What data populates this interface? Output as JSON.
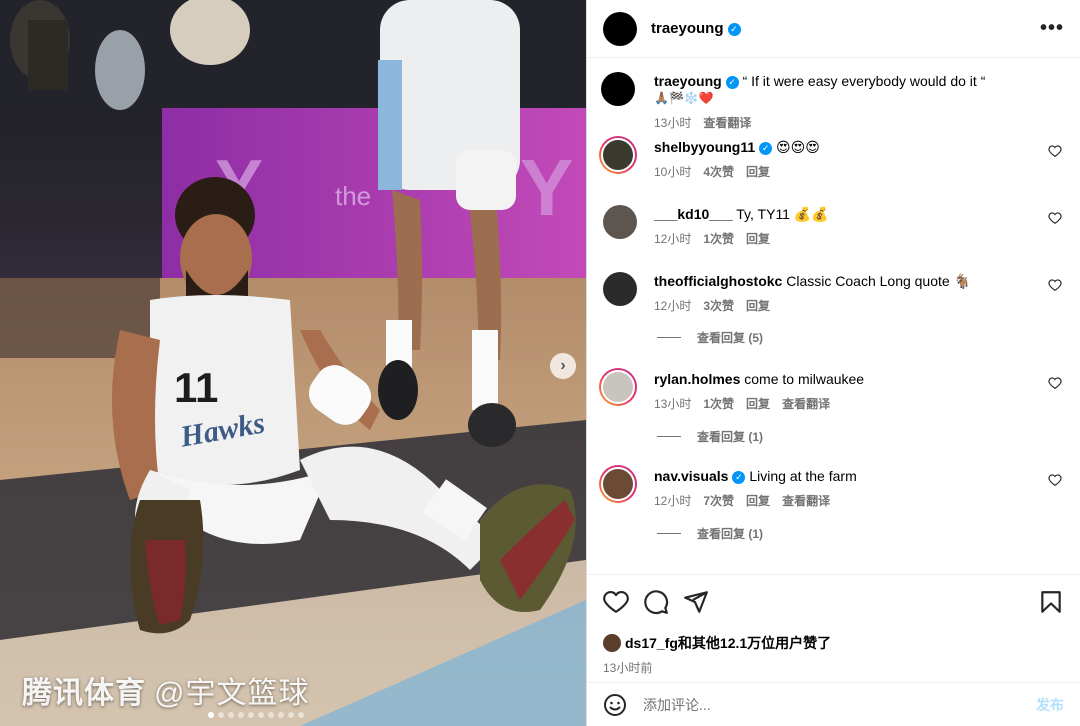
{
  "photo": {
    "jersey_number": "11",
    "jersey_text": "Hawks",
    "watermark_brand": "腾讯体育",
    "watermark_handle": "@宇文篮球",
    "next_icon": "chevron-right-icon",
    "carousel": {
      "total": 10,
      "active_index": 0
    }
  },
  "header": {
    "username": "traeyoung",
    "verified": true,
    "more_icon": "more-horizontal-icon"
  },
  "caption": {
    "username": "traeyoung",
    "text": "“ If it were easy everybody would do it “",
    "emoji_line": "🙏🏽🏁❄️❤️",
    "time": "13小时",
    "translate": "查看翻译"
  },
  "comments": [
    {
      "username": "shelbyyoung11",
      "verified": true,
      "text": "😍😍😍",
      "time": "10小时",
      "likes": "4次赞",
      "reply": "回复",
      "translate": "",
      "view_replies": ""
    },
    {
      "username": "___kd10___",
      "verified": false,
      "text": "Ty, TY11 💰💰",
      "time": "12小时",
      "likes": "1次赞",
      "reply": "回复",
      "translate": "",
      "view_replies": ""
    },
    {
      "username": "theofficialghostokc",
      "verified": false,
      "text": "Classic Coach Long quote 🐐",
      "time": "12小时",
      "likes": "3次赞",
      "reply": "回复",
      "translate": "",
      "view_replies": "查看回复 (5)"
    },
    {
      "username": "rylan.holmes",
      "verified": false,
      "text": "come to milwaukee",
      "time": "13小时",
      "likes": "1次赞",
      "reply": "回复",
      "translate": "查看翻译",
      "view_replies": "查看回复 (1)"
    },
    {
      "username": "nav.visuals",
      "verified": true,
      "text": "Living at the farm",
      "time": "12小时",
      "likes": "7次赞",
      "reply": "回复",
      "translate": "查看翻译",
      "view_replies": "查看回复 (1)"
    }
  ],
  "actions": {
    "like_icon": "heart-icon",
    "comment_icon": "comment-icon",
    "share_icon": "send-icon",
    "save_icon": "bookmark-icon"
  },
  "likes": {
    "first_user": "ds17_fg",
    "rest": "和其他12.1万位用户赞了"
  },
  "post_time": "13小时前",
  "comment_box": {
    "emoji_icon": "emoji-icon",
    "placeholder": "添加评论...",
    "post_label": "发布"
  },
  "colors": {
    "verified": "#0095f6",
    "muted": "#737373",
    "post_disabled": "#b2dffc"
  }
}
